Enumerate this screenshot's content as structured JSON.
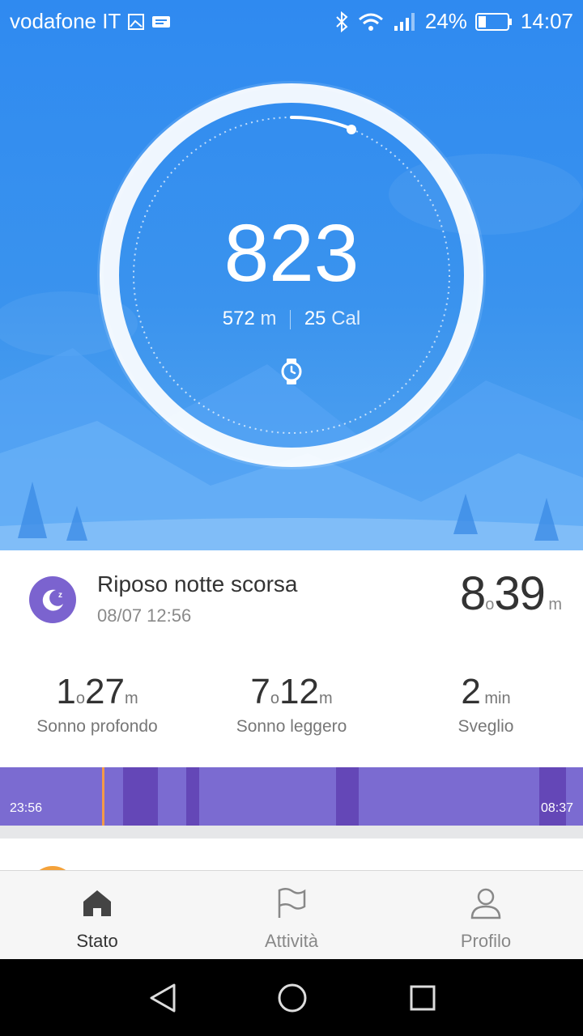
{
  "status_bar": {
    "carrier": "vodafone IT",
    "battery": "24%",
    "time": "14:07"
  },
  "steps": {
    "count": "823",
    "distance_value": "572",
    "distance_unit": "m",
    "calories_value": "25",
    "calories_unit": "Cal"
  },
  "sleep": {
    "title": "Riposo notte scorsa",
    "datetime": "08/07 12:56",
    "total_hours": "8",
    "hours_unit": "o",
    "total_minutes": "39",
    "minutes_unit": "m",
    "stats": [
      {
        "h": "1",
        "h_unit": "o",
        "m": "27",
        "m_unit": "m",
        "label": "Sonno profondo"
      },
      {
        "h": "7",
        "h_unit": "o",
        "m": "12",
        "m_unit": "m",
        "label": "Sonno leggero"
      },
      {
        "value": "2",
        "unit": "min",
        "label": "Sveglio"
      }
    ],
    "timeline_start": "23:56",
    "timeline_end": "08:37"
  },
  "colors": {
    "hero_blue": "#2f8af0",
    "sleep_purple": "#7b6bd1",
    "deep_sleep": "#6447b7",
    "awake_marker": "#f39a48"
  },
  "nav": {
    "items": [
      {
        "label": "Stato",
        "icon": "home-icon",
        "active": true
      },
      {
        "label": "Attività",
        "icon": "flag-icon",
        "active": false
      },
      {
        "label": "Profilo",
        "icon": "person-icon",
        "active": false
      }
    ]
  },
  "system_nav": {
    "icons": [
      "back-icon",
      "home-circle-icon",
      "recents-icon"
    ]
  }
}
